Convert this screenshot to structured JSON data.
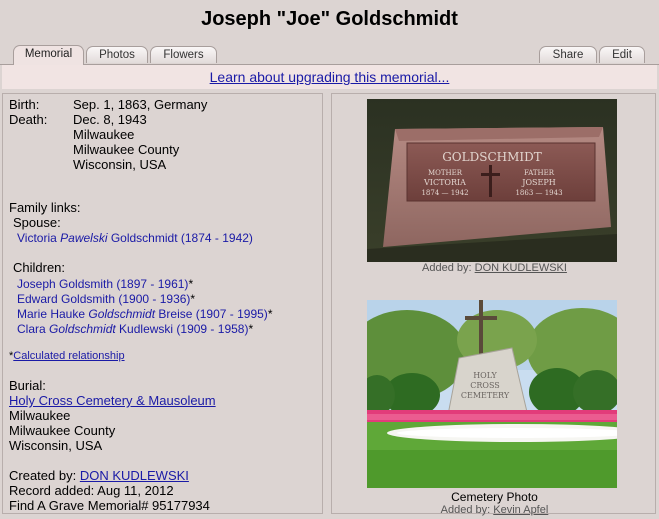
{
  "header": {
    "title": "Joseph \"Joe\" Goldschmidt"
  },
  "tabs": {
    "memorial": "Memorial",
    "photos": "Photos",
    "flowers": "Flowers",
    "share": "Share",
    "edit": "Edit"
  },
  "upgrade_link": "Learn about upgrading this memorial...",
  "vitals": {
    "birth_label": "Birth:",
    "birth_value": "Sep. 1, 1863, Germany",
    "death_label": "Death:",
    "death_date": "Dec. 8, 1943",
    "death_city": "Milwaukee",
    "death_county": "Milwaukee County",
    "death_state": "Wisconsin, USA"
  },
  "family": {
    "heading": "Family links:",
    "spouse_label": "Spouse:",
    "spouse": {
      "first": "Victoria ",
      "maiden": "Pawelski",
      "rest": " Goldschmidt (1874 - 1942)"
    },
    "children_label": "Children:",
    "children": [
      {
        "pre": "Joseph Goldsmith (1897 - 1961)",
        "ital": "",
        "post": "",
        "mark": "*"
      },
      {
        "pre": "Edward Goldsmith (1900 - 1936)",
        "ital": "",
        "post": "",
        "mark": "*"
      },
      {
        "pre": "Marie Hauke ",
        "ital": "Goldschmidt",
        "post": " Breise (1907 - 1995)",
        "mark": "*"
      },
      {
        "pre": "Clara ",
        "ital": "Goldschmidt",
        "post": " Kudlewski (1909 - 1958)",
        "mark": "*"
      }
    ],
    "calc_star": "*",
    "calc_link": "Calculated relationship"
  },
  "burial": {
    "label": "Burial:",
    "cemetery": "Holy Cross Cemetery & Mausoleum",
    "city": "Milwaukee",
    "county": "Milwaukee County",
    "state": "Wisconsin, USA"
  },
  "record": {
    "created_label": "Created by: ",
    "created_by": "DON KUDLEWSKI",
    "added": "Record added: Aug 11, 2012",
    "memorial_id": "Find A Grave Memorial# 95177934"
  },
  "photos": {
    "headstone": {
      "text_surname": "GOLDSCHMIDT",
      "text_left_role": "MOTHER",
      "text_left_name": "VICTORIA",
      "text_left_dates": "1874 — 1942",
      "text_right_role": "FATHER",
      "text_right_name": "JOSEPH",
      "text_right_dates": "1863 — 1943",
      "added_label": "Added by: ",
      "added_by": "DON KUDLEWSKI"
    },
    "cemetery": {
      "sign_line1": "HOLY",
      "sign_line2": "CROSS",
      "sign_line3": "CEMETERY",
      "caption": "Cemetery Photo",
      "added_label": "Added by: ",
      "added_by": "Kevin Apfel"
    }
  },
  "colors": {
    "background": "#dcd4d2",
    "link": "#1a1aa6",
    "upgrade_bar": "#f1e4e3"
  }
}
